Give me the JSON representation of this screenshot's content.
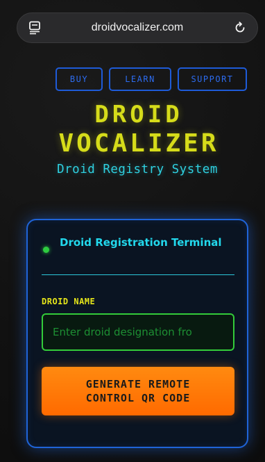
{
  "browser": {
    "url": "droidvocalizer.com",
    "menu_icon": "reader-icon",
    "reload_icon": "reload-icon"
  },
  "nav": {
    "buy": "BUY",
    "learn": "LEARN",
    "support": "SUPPORT"
  },
  "header": {
    "title_line1": "DROID",
    "title_line2": "VOCALIZER",
    "subtitle": "Droid Registry System"
  },
  "card": {
    "heading": "Droid Registration Terminal",
    "status": "online",
    "field_label": "DROID NAME",
    "input_value": "",
    "input_placeholder": "Enter droid designation fro",
    "button_label": "GENERATE REMOTE CONTROL QR CODE"
  },
  "colors": {
    "title": "#d6dc1a",
    "subtitle": "#2fd0e0",
    "nav_border": "#1e5bd8",
    "card_border": "#1f64d8",
    "status_dot": "#2ecc40",
    "input_border": "#33cc3a",
    "button": "#ff7a00"
  }
}
